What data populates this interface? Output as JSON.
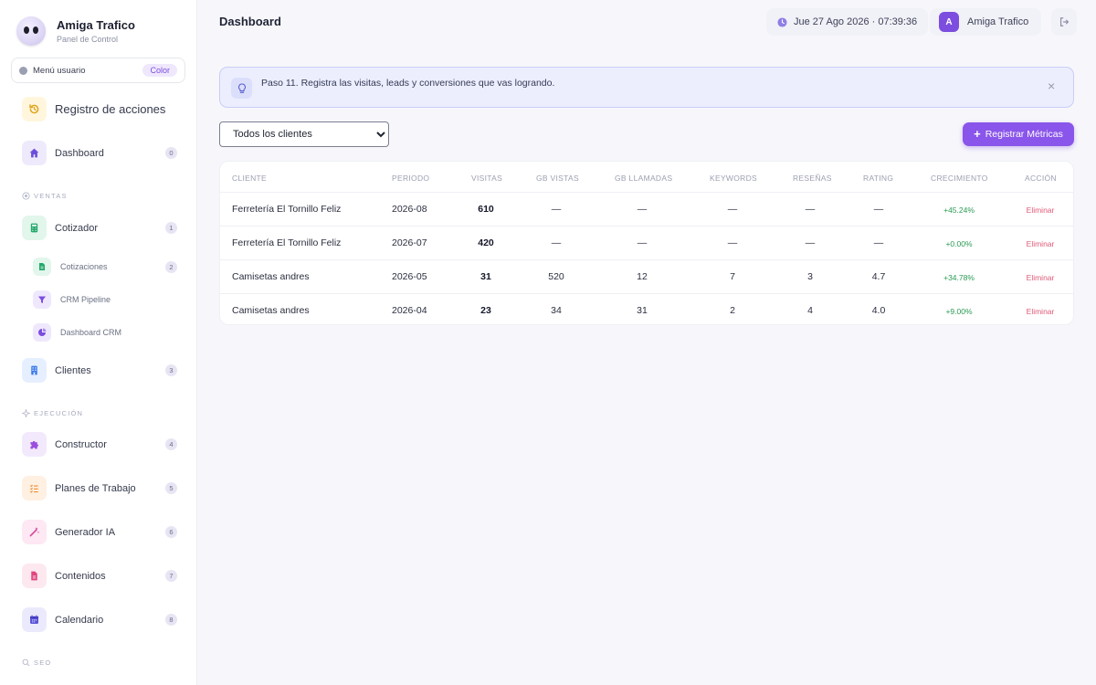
{
  "app": {
    "name": "Amiga Trafico",
    "subtitle": "Panel de Control"
  },
  "user_menu": {
    "label": "Menú usuario",
    "color_label": "Color"
  },
  "sidebar": {
    "history": {
      "label": "Registro de acciones",
      "icon": "history-icon"
    },
    "dashboard": {
      "label": "Dashboard",
      "badge": "0",
      "icon": "home-icon"
    },
    "sections": {
      "ventas": "VENTAS",
      "ejecucion": "EJECUCIÓN",
      "seo": "SEO"
    },
    "cotizador": {
      "label": "Cotizador",
      "badge": "1",
      "icon": "calculator-icon"
    },
    "sub_items": [
      {
        "label": "Cotizaciones",
        "badge": "2",
        "icon": "document-icon"
      },
      {
        "label": "CRM Pipeline",
        "icon": "funnel-icon"
      },
      {
        "label": "Dashboard CRM",
        "icon": "pie-chart-icon"
      }
    ],
    "clientes": {
      "label": "Clientes",
      "badge": "3",
      "icon": "building-icon"
    },
    "constructor": {
      "label": "Constructor",
      "badge": "4",
      "icon": "puzzle-icon"
    },
    "planes": {
      "label": "Planes de Trabajo",
      "badge": "5",
      "icon": "list-icon"
    },
    "generador": {
      "label": "Generador IA",
      "badge": "6",
      "icon": "magic-wand-icon"
    },
    "contenidos": {
      "label": "Contenidos",
      "badge": "7",
      "icon": "file-icon"
    },
    "calendario": {
      "label": "Calendario",
      "badge": "8",
      "icon": "calendar-icon"
    }
  },
  "header": {
    "title": "Dashboard",
    "datetime": "Jue 27 Ago 2026 · 07:39:36",
    "user_initial": "A",
    "user_name": "Amiga Trafico"
  },
  "tip": {
    "text": "Paso 11. Registra las visitas, leads y conversiones que vas logrando.",
    "close": "×"
  },
  "filter": {
    "selected": "Todos los clientes"
  },
  "register_button": {
    "plus": "+",
    "label": "Registrar Métricas"
  },
  "table": {
    "headers": [
      "CLIENTE",
      "PERIODO",
      "VISITAS",
      "GB VISTAS",
      "GB LLAMADAS",
      "KEYWORDS",
      "RESEÑAS",
      "RATING",
      "CRECIMIENTO",
      "ACCIÓN"
    ],
    "rows": [
      {
        "cliente": "Ferretería El Tornillo Feliz",
        "periodo": "2026-08",
        "visitas": "610",
        "gb_vistas": "—",
        "gb_llamadas": "—",
        "keywords": "—",
        "resenas": "—",
        "rating": "—",
        "crecimiento": "+45.24%",
        "accion": "Eliminar"
      },
      {
        "cliente": "Ferretería El Tornillo Feliz",
        "periodo": "2026-07",
        "visitas": "420",
        "gb_vistas": "—",
        "gb_llamadas": "—",
        "keywords": "—",
        "resenas": "—",
        "rating": "—",
        "crecimiento": "+0.00%",
        "accion": "Eliminar"
      },
      {
        "cliente": "Camisetas andres",
        "periodo": "2026-05",
        "visitas": "31",
        "gb_vistas": "520",
        "gb_llamadas": "12",
        "keywords": "7",
        "resenas": "3",
        "rating": "4.7",
        "crecimiento": "+34.78%",
        "accion": "Eliminar"
      },
      {
        "cliente": "Camisetas andres",
        "periodo": "2026-04",
        "visitas": "23",
        "gb_vistas": "34",
        "gb_llamadas": "31",
        "keywords": "2",
        "resenas": "4",
        "rating": "4.0",
        "crecimiento": "+9.00%",
        "accion": "Eliminar"
      }
    ]
  },
  "colors": {
    "accent": "#7c4dde",
    "growth": "#2a9a54",
    "danger": "#e05a78",
    "tip_bg": "#eceefe"
  }
}
